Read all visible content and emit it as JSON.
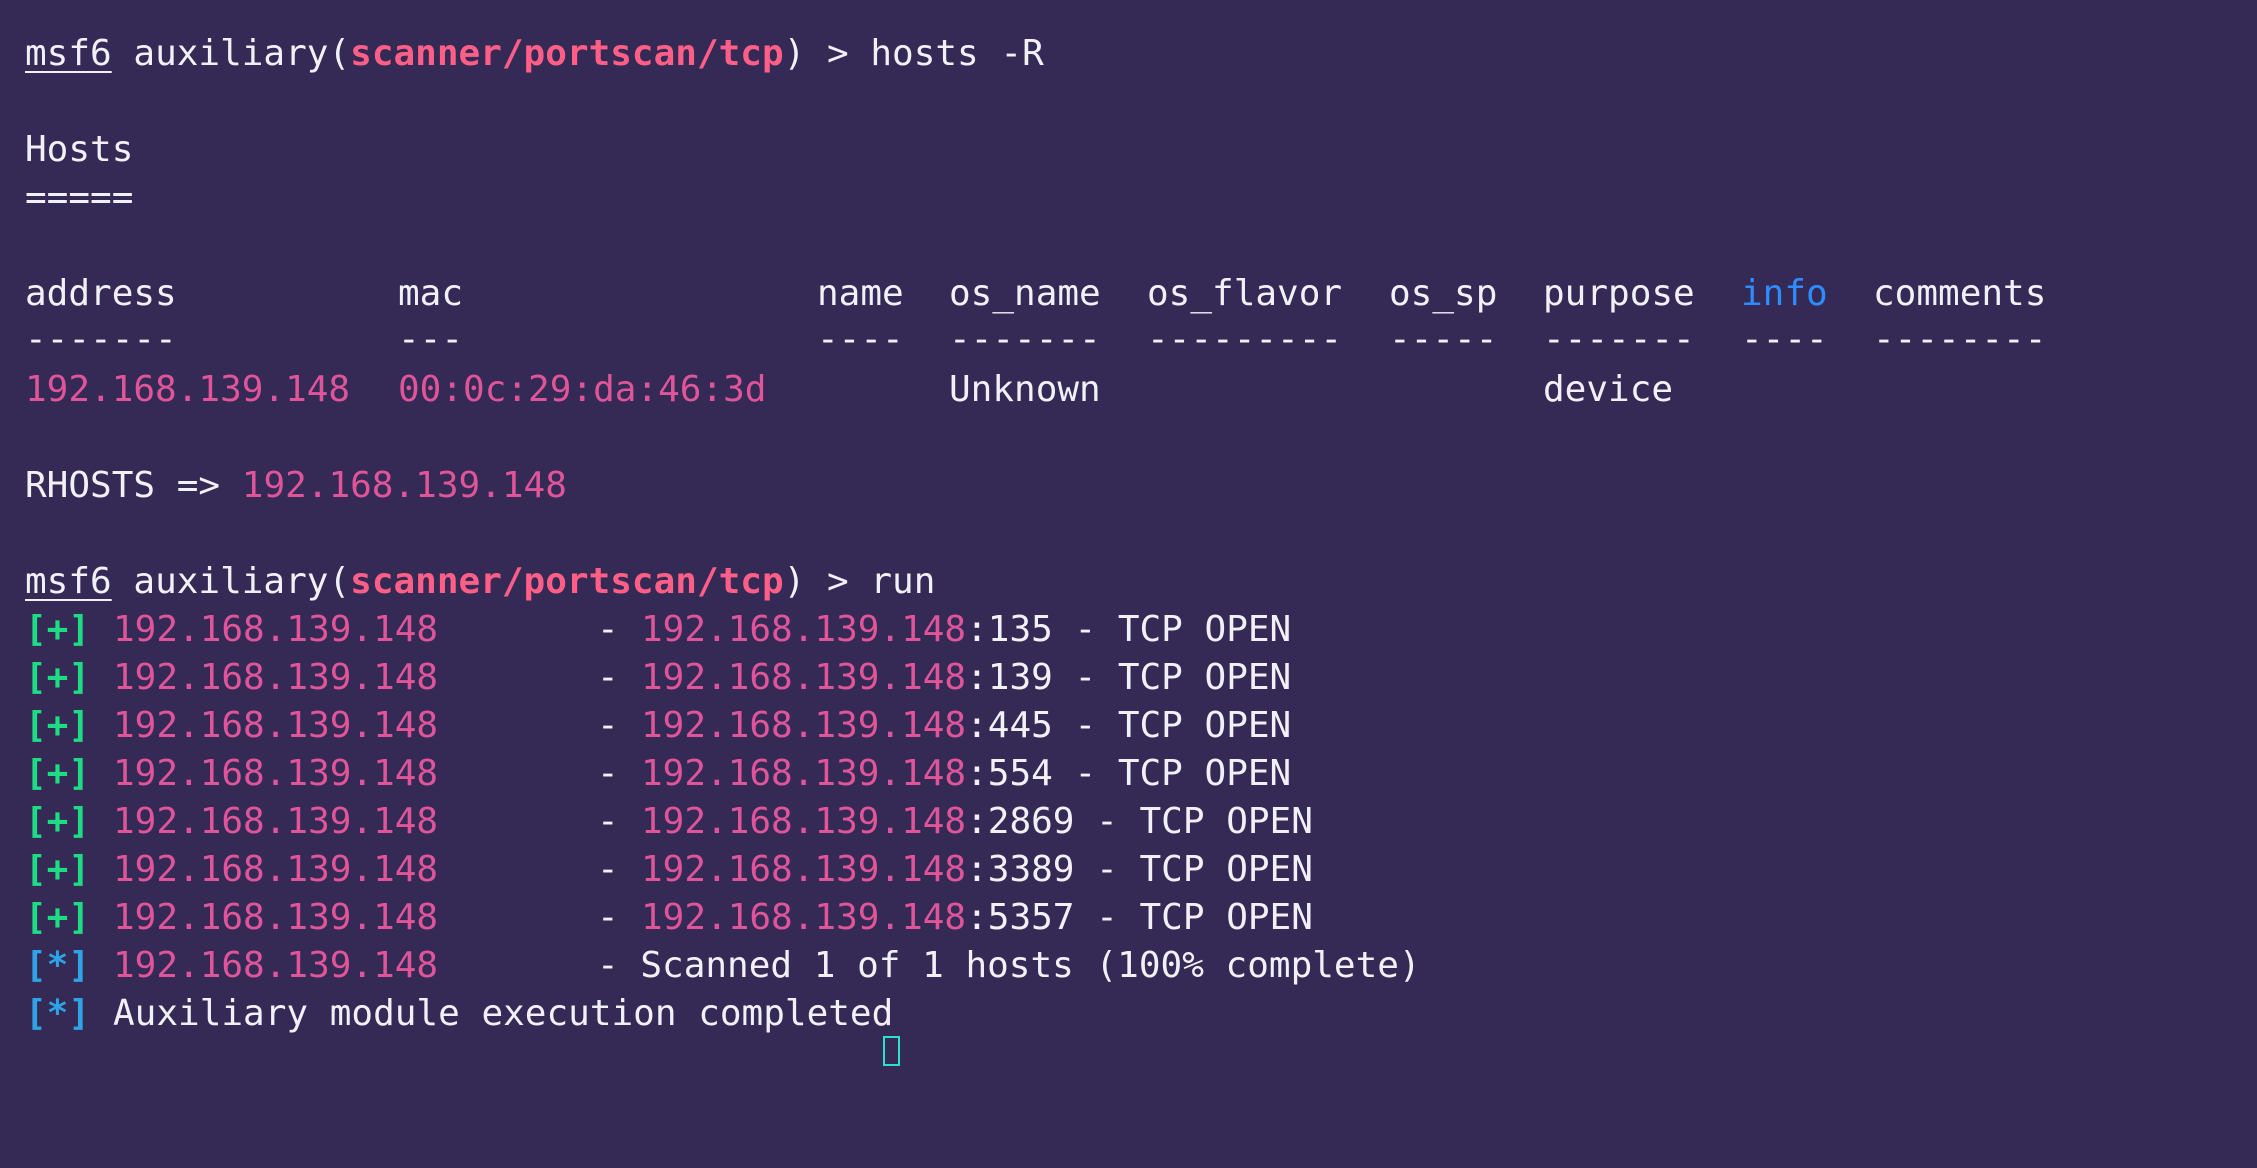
{
  "prompt": {
    "prefix": "msf6",
    "module_word": "auxiliary",
    "open_paren": "(",
    "module_path": "scanner/portscan/tcp",
    "close": ") >",
    "cmd1": "hosts -R",
    "cmd2": "run"
  },
  "hosts_title": "Hosts",
  "hosts_underline": "=====",
  "table": {
    "headers": [
      "address",
      "mac",
      "name",
      "os_name",
      "os_flavor",
      "os_sp",
      "purpose",
      "info",
      "comments"
    ],
    "separators": [
      "-------",
      "---",
      "----",
      "-------",
      "---------",
      "-----",
      "-------",
      "----",
      "--------"
    ],
    "row": {
      "address": "192.168.139.148",
      "mac": "00:0c:29:da:46:3d",
      "os_name": "Unknown",
      "purpose": "device"
    }
  },
  "rhosts": {
    "label": "RHOSTS =>",
    "value": "192.168.139.148"
  },
  "scan": {
    "plus_tag": "[+]",
    "star_tag": "[*]",
    "host": "192.168.139.148",
    "dash": "-",
    "results": [
      {
        "port": ":135",
        "status": " - TCP OPEN"
      },
      {
        "port": ":139",
        "status": " - TCP OPEN"
      },
      {
        "port": ":445",
        "status": " - TCP OPEN"
      },
      {
        "port": ":554",
        "status": " - TCP OPEN"
      },
      {
        "port": ":2869",
        "status": " - TCP OPEN"
      },
      {
        "port": ":3389",
        "status": " - TCP OPEN"
      },
      {
        "port": ":5357",
        "status": " - TCP OPEN"
      }
    ],
    "summary": "- Scanned 1 of 1 hosts (100% complete)",
    "complete": "Auxiliary module execution completed"
  },
  "colors": {
    "background": "#342a55",
    "text": "#f2f0f7",
    "module": "#ff5f87",
    "ip": "#e0559a",
    "success": "#1ddc84",
    "info_status": "#2fa3e6",
    "info_header": "#2d8cff",
    "cursor": "#2de0c8"
  }
}
